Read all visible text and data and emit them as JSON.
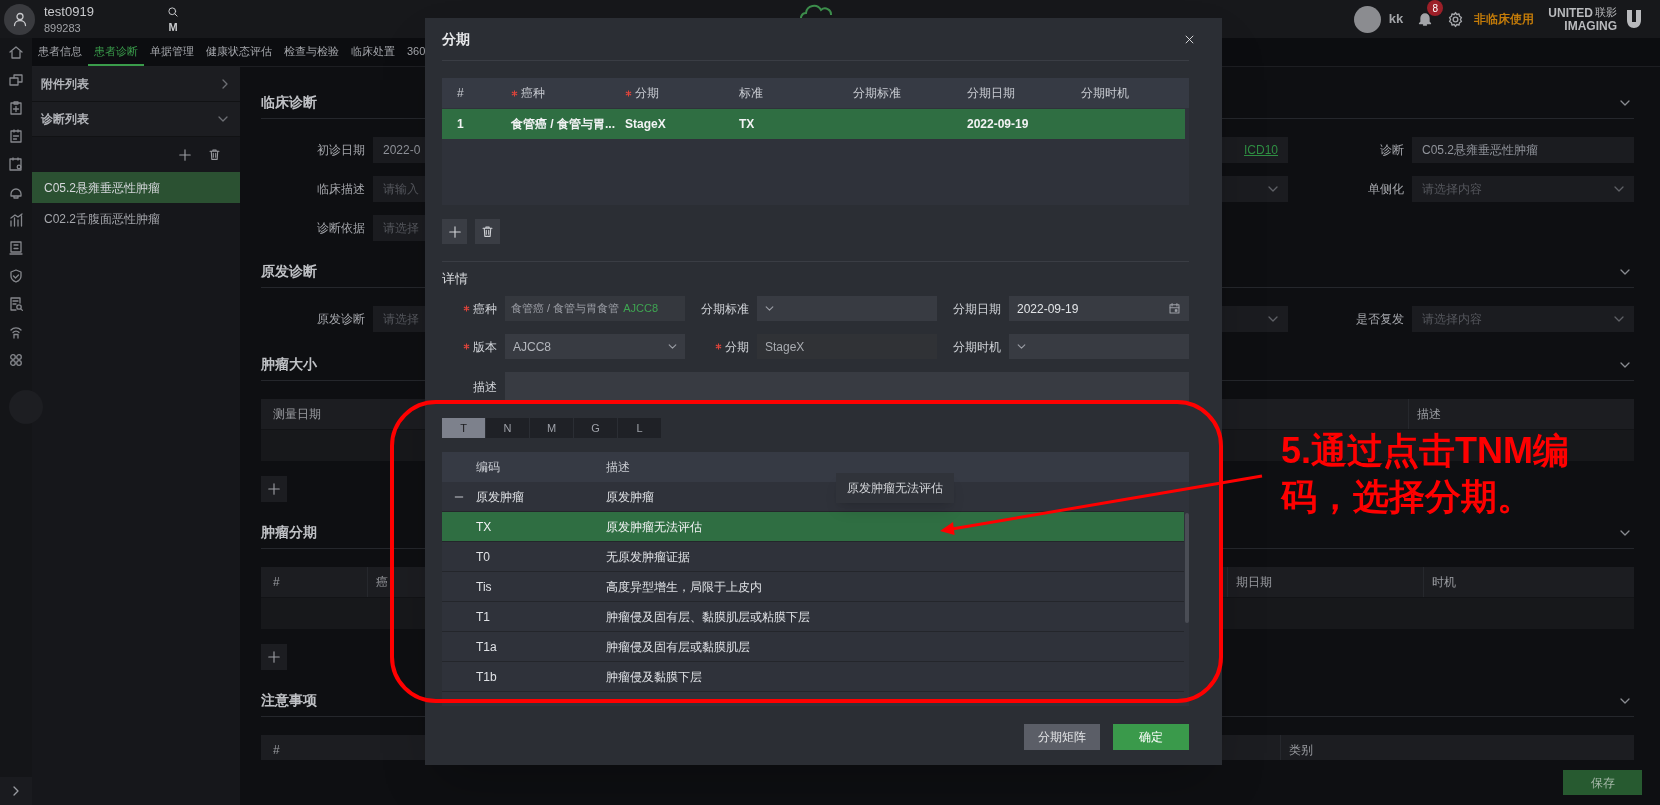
{
  "header": {
    "patient_name": "test0919",
    "patient_id": "899283",
    "search_key": "M",
    "user_name": "kk",
    "notification_count": "8",
    "usage_notice": "非临床使用",
    "brand_line1": "UNITED",
    "brand_line1_cn": "联影",
    "brand_line2": "IMAGING"
  },
  "nav_tabs": [
    {
      "label": "患者信息",
      "selected": false
    },
    {
      "label": "患者诊断",
      "selected": true
    },
    {
      "label": "单据管理",
      "selected": false
    },
    {
      "label": "健康状态评估",
      "selected": false
    },
    {
      "label": "检查与检验",
      "selected": false
    },
    {
      "label": "临床处置",
      "selected": false
    },
    {
      "label": "360",
      "selected": false
    }
  ],
  "sidebar": {
    "sections": [
      {
        "title": "附件列表",
        "expanded": false
      },
      {
        "title": "诊断列表",
        "expanded": true
      }
    ],
    "diagnoses": [
      {
        "label": "C05.2悬雍垂恶性肿瘤",
        "selected": true
      },
      {
        "label": "C02.2舌腹面恶性肿瘤",
        "selected": false
      }
    ]
  },
  "main": {
    "sections": [
      {
        "kind": "form",
        "title": "临床诊断",
        "rows": [
          [
            {
              "kind": "text",
              "label": "初诊日期",
              "value": "2022-0"
            },
            {
              "kind": "link",
              "value": "ICD10"
            },
            {
              "kind": "text",
              "label": "诊断",
              "value": "C05.2悬雍垂恶性肿瘤"
            }
          ],
          [
            {
              "kind": "input",
              "label": "临床描述",
              "placeholder": "请输入"
            },
            {
              "kind": "select"
            },
            {
              "kind": "select",
              "label": "单侧化",
              "placeholder": "请选择内容"
            }
          ],
          [
            {
              "kind": "input",
              "label": "诊断依据",
              "placeholder": "请选择"
            }
          ]
        ]
      },
      {
        "kind": "form",
        "title": "原发诊断",
        "rows": [
          [
            {
              "kind": "input",
              "label": "原发诊断",
              "placeholder": "请选择"
            },
            {
              "kind": "select"
            },
            {
              "kind": "select",
              "label": "是否复发",
              "placeholder": "请选择内容"
            }
          ]
        ]
      },
      {
        "kind": "table",
        "title": "肿瘤大小",
        "columns": [
          "测量日期",
          "描述"
        ],
        "add_button": true
      },
      {
        "kind": "table",
        "title": "肿瘤分期",
        "columns": [
          "#",
          "癌",
          "期日期",
          "时机"
        ],
        "add_button": true
      },
      {
        "kind": "table",
        "title": "注意事项",
        "columns": [
          "#",
          "类别"
        ]
      }
    ],
    "save_button": "保存"
  },
  "modal": {
    "title": "分期",
    "staging_table": {
      "columns": [
        {
          "label": "#",
          "required": false
        },
        {
          "label": "癌种",
          "required": true
        },
        {
          "label": "分期",
          "required": true
        },
        {
          "label": "标准",
          "required": false
        },
        {
          "label": "分期标准",
          "required": false
        },
        {
          "label": "分期日期",
          "required": false
        },
        {
          "label": "分期时机",
          "required": false
        }
      ],
      "rows": [
        {
          "index": "1",
          "cancer": "食管癌 / 食管与胃...",
          "stage": "StageX",
          "standard": "TX",
          "date": "2022-09-19",
          "selected": true
        }
      ]
    },
    "details": {
      "title": "详情",
      "fields": [
        {
          "kind": "cascader",
          "label": "癌种",
          "required": true,
          "value": "食管癌 / 食管与胃食管",
          "tag": "AJCC8"
        },
        {
          "kind": "select",
          "label": "分期标准",
          "required": false
        },
        {
          "kind": "date",
          "label": "分期日期",
          "required": false,
          "value": "2022-09-19"
        },
        {
          "kind": "select",
          "label": "版本",
          "required": true,
          "value": "AJCC8"
        },
        {
          "kind": "readonly",
          "label": "分期",
          "required": true,
          "value": "StageX"
        },
        {
          "kind": "select",
          "label": "分期时机",
          "required": false
        },
        {
          "kind": "textarea",
          "label": "描述",
          "required": false
        }
      ]
    },
    "tnm_tabs": [
      {
        "label": "T",
        "selected": true
      },
      {
        "label": "N",
        "selected": false
      },
      {
        "label": "M",
        "selected": false
      },
      {
        "label": "G",
        "selected": false
      },
      {
        "label": "L",
        "selected": false
      }
    ],
    "code_table": {
      "columns": [
        "编码",
        "描述"
      ],
      "groups": [
        {
          "code": "原发肿瘤",
          "description": "原发肿瘤",
          "expanded": true,
          "children": [
            {
              "code": "TX",
              "description": "原发肿瘤无法评估",
              "selected": true
            },
            {
              "code": "T0",
              "description": "无原发肿瘤证据",
              "selected": false
            },
            {
              "code": "Tis",
              "description": "高度异型增生，局限于上皮内",
              "selected": false
            },
            {
              "code": "T1",
              "description": "肿瘤侵及固有层、黏膜肌层或粘膜下层",
              "selected": false
            },
            {
              "code": "T1a",
              "description": "肿瘤侵及固有层或黏膜肌层",
              "selected": false
            },
            {
              "code": "T1b",
              "description": "肿瘤侵及黏膜下层",
              "selected": false
            }
          ]
        }
      ]
    },
    "tooltip": "原发肿瘤无法评估",
    "buttons": [
      {
        "label": "分期矩阵",
        "kind": "secondary"
      },
      {
        "label": "确定",
        "kind": "primary"
      }
    ]
  },
  "annotation": {
    "text": "5.通过点击TNM编码，选择分期。"
  }
}
